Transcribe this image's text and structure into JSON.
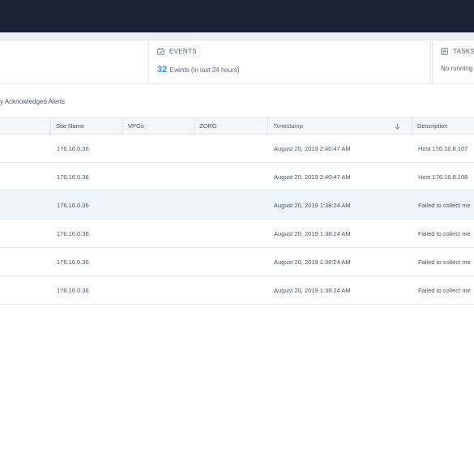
{
  "summary": {
    "events": {
      "icon": "calendar-check-icon",
      "title": "EVENTS",
      "count": "32",
      "suffix": "Events (in last 24 hours)"
    },
    "tasks": {
      "icon": "tasks-icon",
      "title": "TASKS",
      "text": "No running"
    }
  },
  "filter": {
    "label": "y Acknowledged Alerts"
  },
  "table": {
    "columns": {
      "site_name": "Site Name",
      "vpgs": "VPGs",
      "zorg": "ZORG",
      "timestamp": "Timestamp",
      "description": "Description"
    },
    "sort": {
      "column": "timestamp",
      "direction": "descending",
      "icon": "arrow-down-icon"
    },
    "rows": [
      {
        "site": "176.16.0.36",
        "vpgs": "",
        "zorg": "",
        "timestamp": "August 20, 2019 2:40:47 AM",
        "description": "Host 176.16.8.107"
      },
      {
        "site": "176.16.0.36",
        "vpgs": "",
        "zorg": "",
        "timestamp": "August 20, 2019 2:40:47 AM",
        "description": "Host 176.16.8.108"
      },
      {
        "site": "176.16.0.36",
        "vpgs": "",
        "zorg": "",
        "timestamp": "August 20, 2019 1:38:24 AM",
        "description": "Failed to collect me"
      },
      {
        "site": "176.16.0.36",
        "vpgs": "",
        "zorg": "",
        "timestamp": "August 20, 2019 1:38:24 AM",
        "description": "Failed to collect me"
      },
      {
        "site": "176.16.0.36",
        "vpgs": "",
        "zorg": "",
        "timestamp": "August 20, 2019 1:38:24 AM",
        "description": "Failed to collect me"
      },
      {
        "site": "176.16.0.36",
        "vpgs": "",
        "zorg": "",
        "timestamp": "August 20, 2019 1:38:24 AM",
        "description": "Failed to collect me"
      }
    ],
    "highlighted_row": 2
  },
  "colors": {
    "topbar": "#1c2336",
    "accent": "#2d8fd6",
    "highlight_row": "#eef6fc"
  }
}
